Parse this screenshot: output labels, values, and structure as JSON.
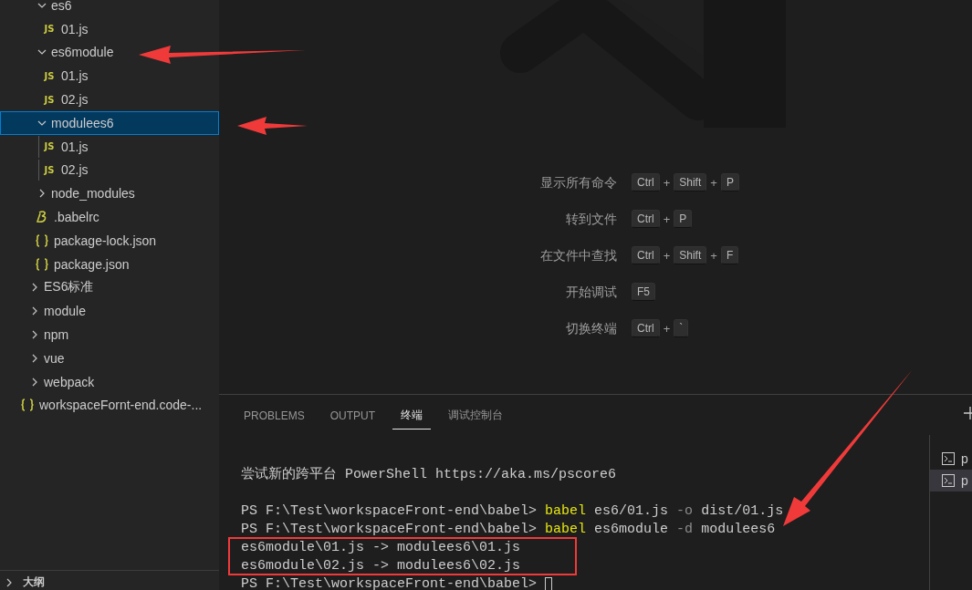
{
  "sidebar": {
    "tree": [
      {
        "children": [
          {
            "children": [
              {
                "label": "es6",
                "kind": "folder",
                "expanded": true,
                "selected": false,
                "children": [
                  {
                    "label": "01.js",
                    "kind": "js",
                    "badge": "JS",
                    "selected": false
                  }
                ]
              },
              {
                "label": "es6module",
                "kind": "folder",
                "expanded": true,
                "selected": false,
                "children": [
                  {
                    "label": "01.js",
                    "kind": "js",
                    "badge": "JS",
                    "selected": false
                  },
                  {
                    "label": "02.js",
                    "kind": "js",
                    "badge": "JS",
                    "selected": false
                  }
                ]
              },
              {
                "label": "modulees6",
                "kind": "folder",
                "expanded": true,
                "selected": true,
                "children": [
                  {
                    "label": "01.js",
                    "kind": "js",
                    "badge": "JS",
                    "selected": false
                  },
                  {
                    "label": "02.js",
                    "kind": "js",
                    "badge": "JS",
                    "selected": false
                  }
                ]
              },
              {
                "label": "node_modules",
                "kind": "folder",
                "expanded": false,
                "selected": false
              },
              {
                "label": ".babelrc",
                "kind": "babel",
                "selected": false
              },
              {
                "label": "package-lock.json",
                "kind": "json",
                "selected": false
              },
              {
                "label": "package.json",
                "kind": "json",
                "selected": false
              }
            ]
          },
          {
            "label": "ES6标准",
            "kind": "folder",
            "expanded": false,
            "selected": false
          },
          {
            "label": "module",
            "kind": "folder",
            "expanded": false,
            "selected": false
          },
          {
            "label": "npm",
            "kind": "folder",
            "expanded": false,
            "selected": false
          },
          {
            "label": "vue",
            "kind": "folder",
            "expanded": false,
            "selected": false
          },
          {
            "label": "webpack",
            "kind": "folder",
            "expanded": false,
            "selected": false
          }
        ]
      },
      {
        "label": "workspaceFornt-end.code-...",
        "kind": "json",
        "selected": false
      }
    ],
    "outline": {
      "label": "大纲",
      "expanded": false
    }
  },
  "editor": {
    "shortcuts": [
      {
        "label": "显示所有命令",
        "keys": [
          {
            "kind": "key",
            "text": "Ctrl"
          },
          {
            "kind": "plus",
            "text": "+"
          },
          {
            "kind": "key",
            "text": "Shift"
          },
          {
            "kind": "plus",
            "text": "+"
          },
          {
            "kind": "key",
            "text": "P"
          }
        ]
      },
      {
        "label": "转到文件",
        "keys": [
          {
            "kind": "key",
            "text": "Ctrl"
          },
          {
            "kind": "plus",
            "text": "+"
          },
          {
            "kind": "key",
            "text": "P"
          }
        ]
      },
      {
        "label": "在文件中查找",
        "keys": [
          {
            "kind": "key",
            "text": "Ctrl"
          },
          {
            "kind": "plus",
            "text": "+"
          },
          {
            "kind": "key",
            "text": "Shift"
          },
          {
            "kind": "plus",
            "text": "+"
          },
          {
            "kind": "key",
            "text": "F"
          }
        ]
      },
      {
        "label": "开始调试",
        "keys": [
          {
            "kind": "key",
            "text": "F5"
          }
        ]
      },
      {
        "label": "切换终端",
        "keys": [
          {
            "kind": "key",
            "text": "Ctrl"
          },
          {
            "kind": "plus",
            "text": "+"
          },
          {
            "kind": "key",
            "text": "`"
          }
        ]
      }
    ]
  },
  "panel": {
    "tabs": [
      {
        "label": "PROBLEMS",
        "selected": false
      },
      {
        "label": "OUTPUT",
        "selected": false
      },
      {
        "label": "终端",
        "selected": true
      },
      {
        "label": "调试控制台",
        "selected": false
      }
    ],
    "terminal": {
      "lines": [
        {
          "kind": "text",
          "cursor": false,
          "segments": [
            {
              "kind": "plain",
              "text": "尝试新的跨平台 PowerShell https://aka.ms/pscore6"
            }
          ]
        },
        {
          "kind": "blank"
        },
        {
          "kind": "text",
          "cursor": false,
          "segments": [
            {
              "kind": "plain",
              "text": "PS F:\\Test\\workspaceFront-end\\babel> "
            },
            {
              "kind": "command",
              "text": "babel"
            },
            {
              "kind": "plain",
              "text": " es6/01.js "
            },
            {
              "kind": "flag",
              "text": "-o"
            },
            {
              "kind": "plain",
              "text": " dist/01.js"
            }
          ]
        },
        {
          "kind": "text",
          "cursor": false,
          "segments": [
            {
              "kind": "plain",
              "text": "PS F:\\Test\\workspaceFront-end\\babel> "
            },
            {
              "kind": "command",
              "text": "babel"
            },
            {
              "kind": "plain",
              "text": " es6module "
            },
            {
              "kind": "flag",
              "text": "-d"
            },
            {
              "kind": "plain",
              "text": " modulees6"
            }
          ]
        },
        {
          "kind": "text",
          "cursor": false,
          "segments": [
            {
              "kind": "plain",
              "text": "es6module\\01.js -> modulees6\\01.js"
            }
          ]
        },
        {
          "kind": "text",
          "cursor": false,
          "segments": [
            {
              "kind": "plain",
              "text": "es6module\\02.js -> modulees6\\02.js"
            }
          ]
        },
        {
          "kind": "text",
          "cursor": true,
          "segments": [
            {
              "kind": "plain",
              "text": "PS F:\\Test\\workspaceFront-end\\babel> "
            }
          ]
        }
      ]
    },
    "terminals": [
      {
        "label": "p",
        "selected": false
      },
      {
        "label": "p",
        "selected": true
      }
    ]
  }
}
